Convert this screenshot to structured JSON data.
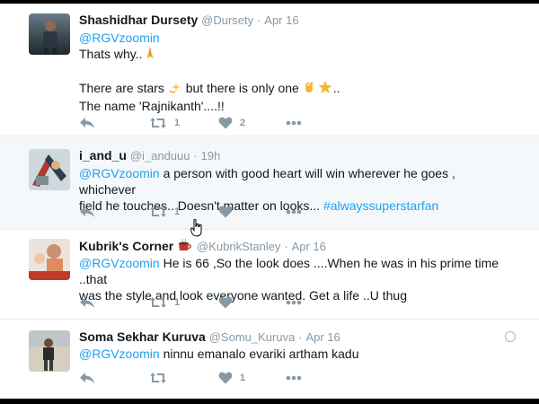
{
  "tweets": [
    {
      "name": "Shashidhar Dursety",
      "handle": "@Dursety",
      "sep": "·",
      "time": "Apr 16",
      "mention": "@RGVzoomin",
      "line1": "Thats why..",
      "line2a": "There are stars",
      "line2b": "but there is only one",
      "line2c": "..",
      "line3": "The name 'Rajnikanth'....!!",
      "retweets": "1",
      "likes": "2"
    },
    {
      "name": "i_and_u",
      "handle": "@i_anduuu",
      "sep": "·",
      "time": "19h",
      "mention": "@RGVzoomin",
      "text1": " a person with good heart will win wherever he goes , whichever",
      "text2": "field he touches.. Doesn't matter on looks... ",
      "hashtag": "#alwayssuperstarfan",
      "retweets": "1",
      "likes": ""
    },
    {
      "name": "Kubrik's Corner",
      "handle": "@KubrikStanley",
      "sep": "·",
      "time": "Apr 16",
      "mention": "@RGVzoomin",
      "text1": " He is 66 ,So the look does ....When he was in his prime time ..that",
      "text2": "was the style and look everyone wanted. Get a life ..U thug",
      "retweets": "1",
      "likes": ""
    },
    {
      "name": "Soma Sekhar Kuruva",
      "handle": "@Somu_Kuruva",
      "sep": "·",
      "time": "Apr 16",
      "mention": "@RGVzoomin",
      "text1": " ninnu emanalo evariki artham kadu",
      "retweets": "",
      "likes": "1"
    }
  ],
  "colors": {
    "link": "#1da1f2",
    "meta": "#8899a6",
    "highlight": "#f5f8fa",
    "like_red": "#8899a6"
  },
  "icons": [
    "reply-icon",
    "retweet-icon",
    "heart-icon",
    "more-icon",
    "globe-icon",
    "pray-emoji",
    "dizzy-star-emoji",
    "ok-hand-emoji",
    "star-emoji",
    "coffee-emoji",
    "hand-cursor-icon"
  ]
}
